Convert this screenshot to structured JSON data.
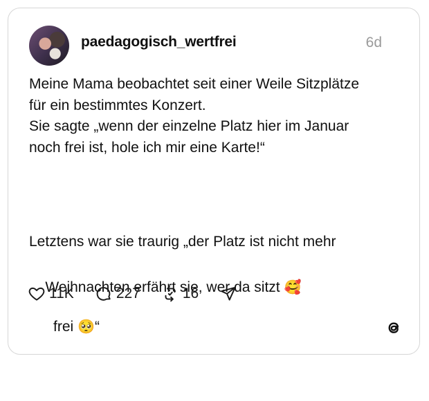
{
  "post": {
    "username": "paedagogisch_wertfrei",
    "time": "6d",
    "paragraph1": "Meine Mama beobachtet seit einer Weile Sitzplätze\nfür ein bestimmtes Konzert.\nSie sagte „wenn der einzelne Platz hier im Januar\nnoch frei ist, hole ich mir eine Karte!“",
    "paragraph2_line1": "Letztens war sie traurig „der Platz ist nicht mehr",
    "paragraph2_line2_text": "frei ",
    "paragraph2_emoji": "🥺",
    "paragraph2_line2_end": "“",
    "paragraph3_text": "Weihnachten erfährt sie, wer da sitzt ",
    "paragraph3_emoji": "🥰"
  },
  "actions": {
    "likes": "11K",
    "comments": "227",
    "reposts": "16"
  },
  "icons": {
    "like": "heart-icon",
    "comment": "speech-bubble-icon",
    "repost": "repost-icon",
    "share": "send-icon",
    "brand": "threads-logo-icon"
  }
}
